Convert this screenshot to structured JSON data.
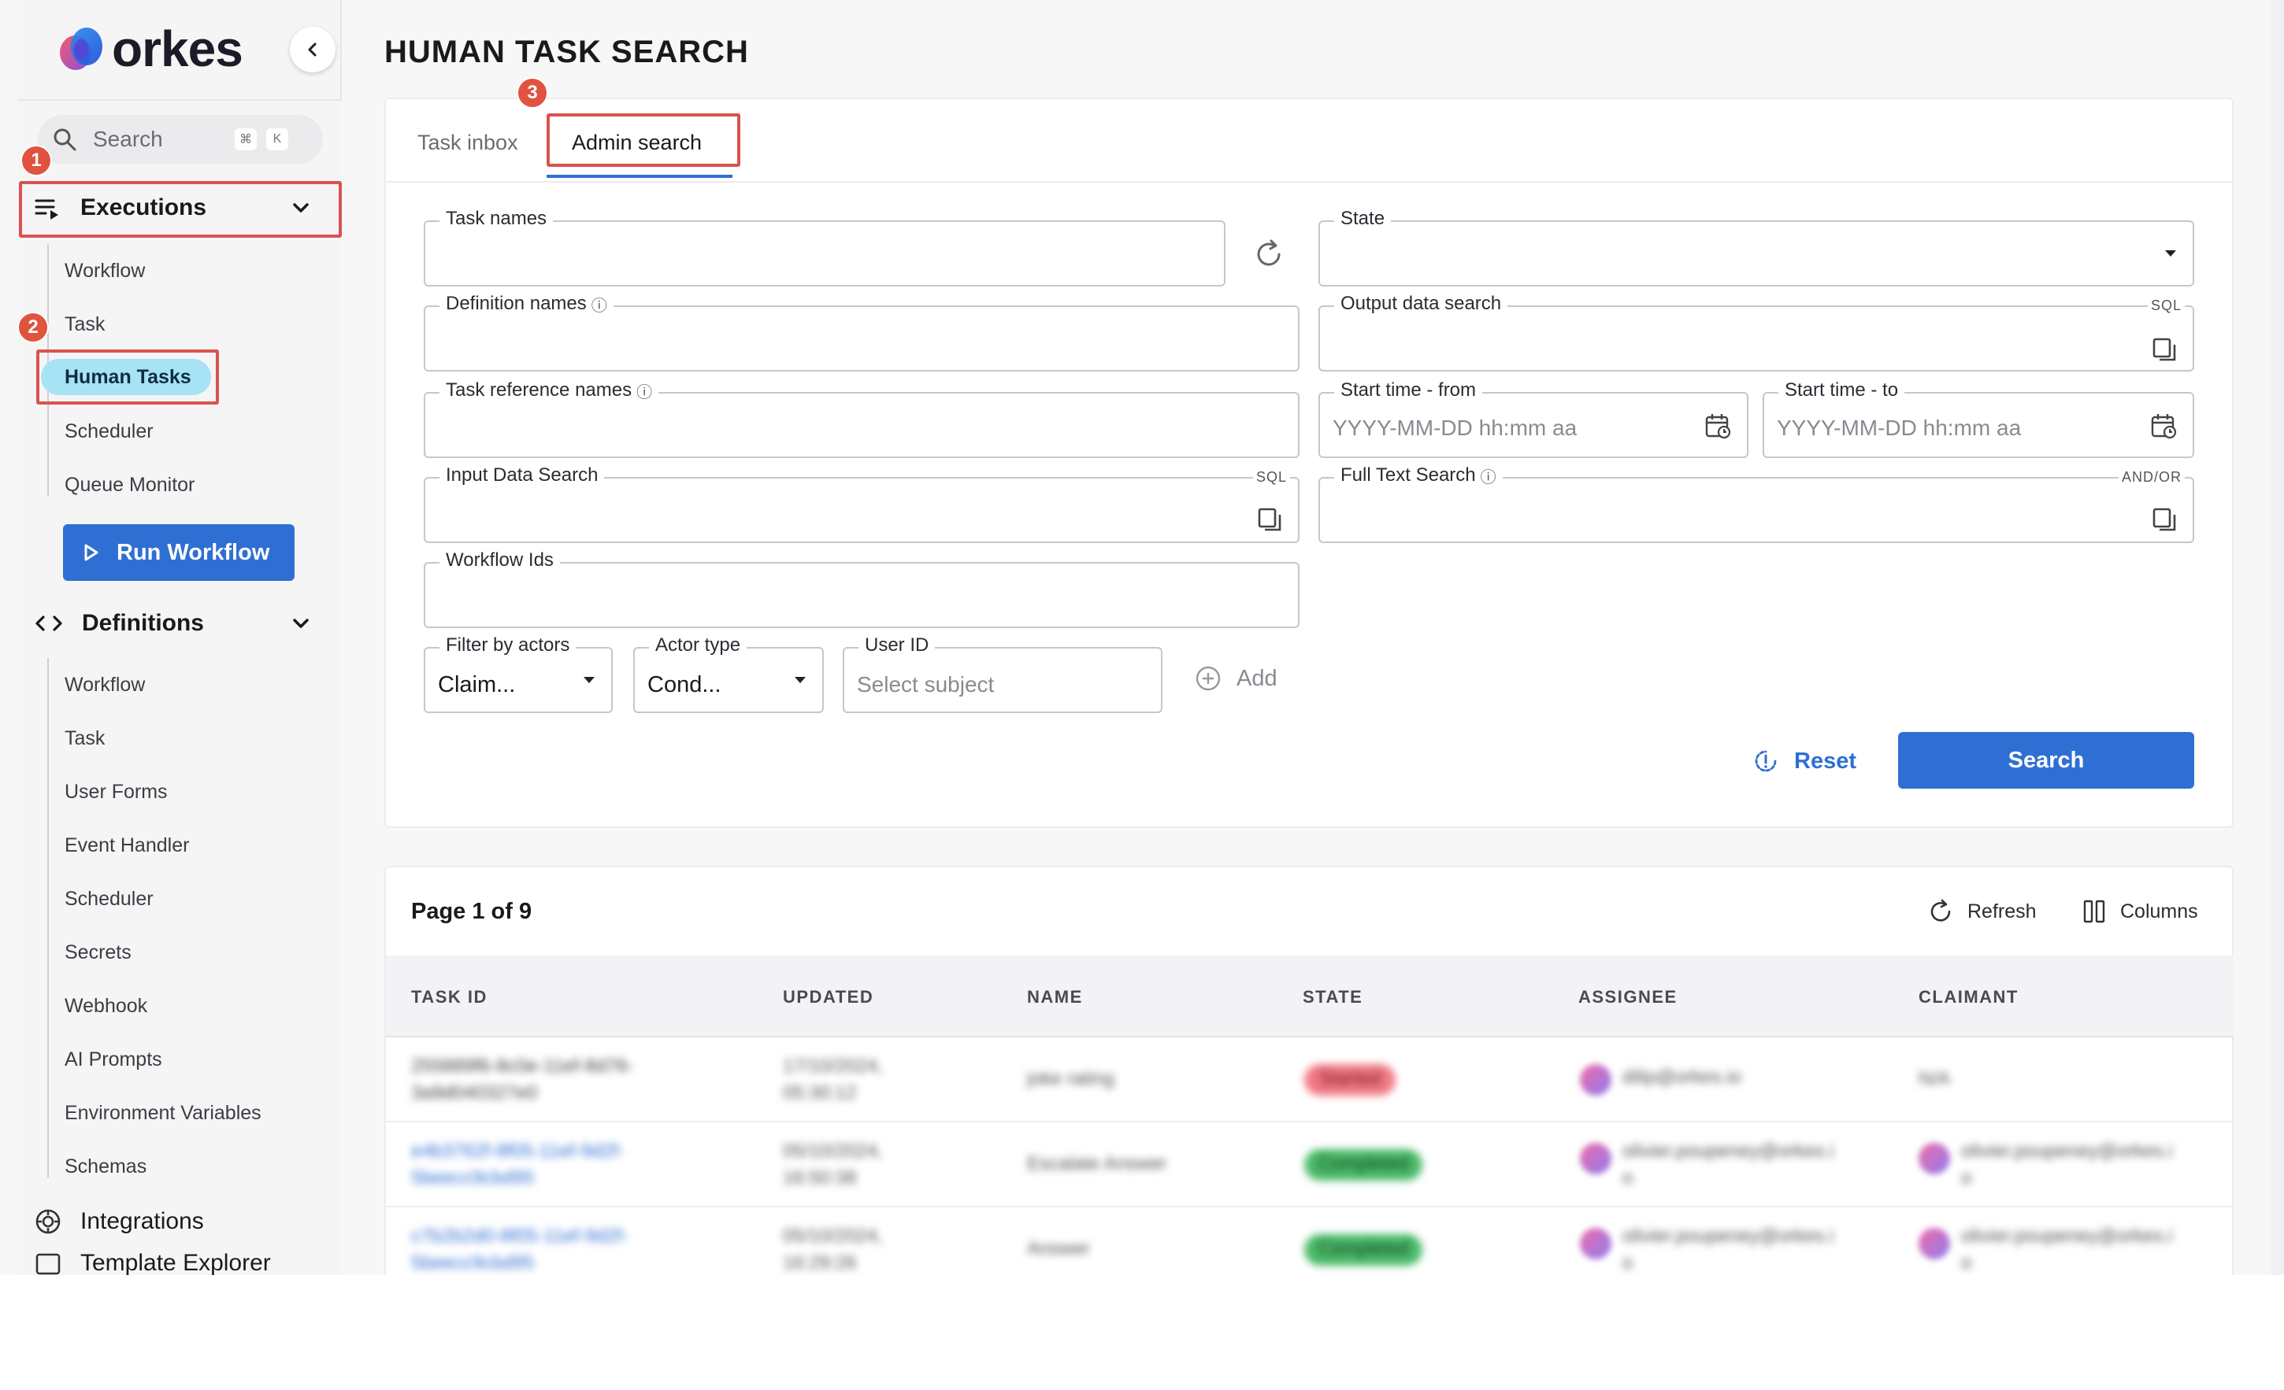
{
  "brand": {
    "name": "orkes"
  },
  "page_title": "HUMAN TASK SEARCH",
  "sidebar": {
    "search": {
      "placeholder": "Search",
      "shortcut": [
        "⌘",
        "K"
      ]
    },
    "executions": {
      "label": "Executions",
      "items": [
        {
          "label": "Workflow"
        },
        {
          "label": "Task"
        },
        {
          "label": "Human Tasks",
          "active": true
        },
        {
          "label": "Scheduler"
        },
        {
          "label": "Queue Monitor"
        }
      ]
    },
    "run_workflow": "Run Workflow",
    "definitions": {
      "label": "Definitions",
      "items": [
        {
          "label": "Workflow"
        },
        {
          "label": "Task"
        },
        {
          "label": "User Forms"
        },
        {
          "label": "Event Handler"
        },
        {
          "label": "Scheduler"
        },
        {
          "label": "Secrets"
        },
        {
          "label": "Webhook"
        },
        {
          "label": "AI Prompts"
        },
        {
          "label": "Environment Variables"
        },
        {
          "label": "Schemas"
        }
      ]
    },
    "integrations": "Integrations",
    "partial_next": "Template Explorer"
  },
  "annotations": [
    "1",
    "2",
    "3"
  ],
  "tabs": [
    {
      "label": "Task inbox",
      "active": false
    },
    {
      "label": "Admin search",
      "active": true
    }
  ],
  "form": {
    "task_names": {
      "label": "Task names",
      "value": ""
    },
    "state": {
      "label": "State",
      "value": ""
    },
    "definition_names": {
      "label": "Definition names",
      "value": ""
    },
    "output_data_search": {
      "label": "Output data search",
      "tag": "SQL"
    },
    "task_reference_names": {
      "label": "Task reference names",
      "value": ""
    },
    "start_time_from": {
      "label": "Start time - from",
      "placeholder": "YYYY-MM-DD hh:mm aa"
    },
    "start_time_to": {
      "label": "Start time - to",
      "placeholder": "YYYY-MM-DD hh:mm aa"
    },
    "input_data_search": {
      "label": "Input Data Search",
      "tag": "SQL"
    },
    "full_text_search": {
      "label": "Full Text Search",
      "tag": "AND/OR"
    },
    "workflow_ids": {
      "label": "Workflow Ids",
      "value": ""
    },
    "filter_by_actors": {
      "label": "Filter by actors",
      "value": "Claim..."
    },
    "actor_type": {
      "label": "Actor type",
      "value": "Cond..."
    },
    "user_id": {
      "label": "User ID",
      "placeholder": "Select subject"
    },
    "add_label": "Add",
    "reset_label": "Reset",
    "search_label": "Search"
  },
  "results": {
    "page_info": "Page 1 of 9",
    "refresh_label": "Refresh",
    "columns_label": "Columns",
    "headers": [
      "TASK ID",
      "UPDATED",
      "NAME",
      "STATE",
      "ASSIGNEE",
      "CLAIMANT"
    ],
    "rows": [
      {
        "task_id": [
          "255889f6-8c0e-11ef-8d76-",
          "3a9d040327e0"
        ],
        "updated": [
          "17/10/2024,",
          "05:30:12"
        ],
        "name": "joke rating",
        "state": "Started",
        "assignee": "dilip@orkes.io",
        "claimant": "N/A"
      },
      {
        "task_id": [
          "e4b3762f-8f05-11ef-9d2f-",
          "5beecc9cbd95"
        ],
        "updated": [
          "05/10/2024,",
          "16:50:38"
        ],
        "name": "Escalate Answer",
        "state": "Completed",
        "assignee": [
          "olivier.poupeney@orkes.i",
          "o"
        ],
        "claimant": [
          "olivier.poupeney@orkes.i",
          "o"
        ]
      },
      {
        "task_id": [
          "c7b2b2d0-8f05-11ef-9d2f-",
          "5beecc9cbd95"
        ],
        "updated": [
          "05/10/2024,",
          "16:29:26"
        ],
        "name": "Answer",
        "state": "Completed",
        "assignee": [
          "olivier.poupeney@orkes.i",
          "o"
        ],
        "claimant": [
          "olivier.poupeney@orkes.i",
          "o"
        ]
      }
    ]
  },
  "colors": {
    "primary": "#2f6fd3",
    "highlight": "#d9534f",
    "active_nav": "#a8e3f5",
    "started": "#f07a84",
    "completed": "#4cbb6a"
  }
}
